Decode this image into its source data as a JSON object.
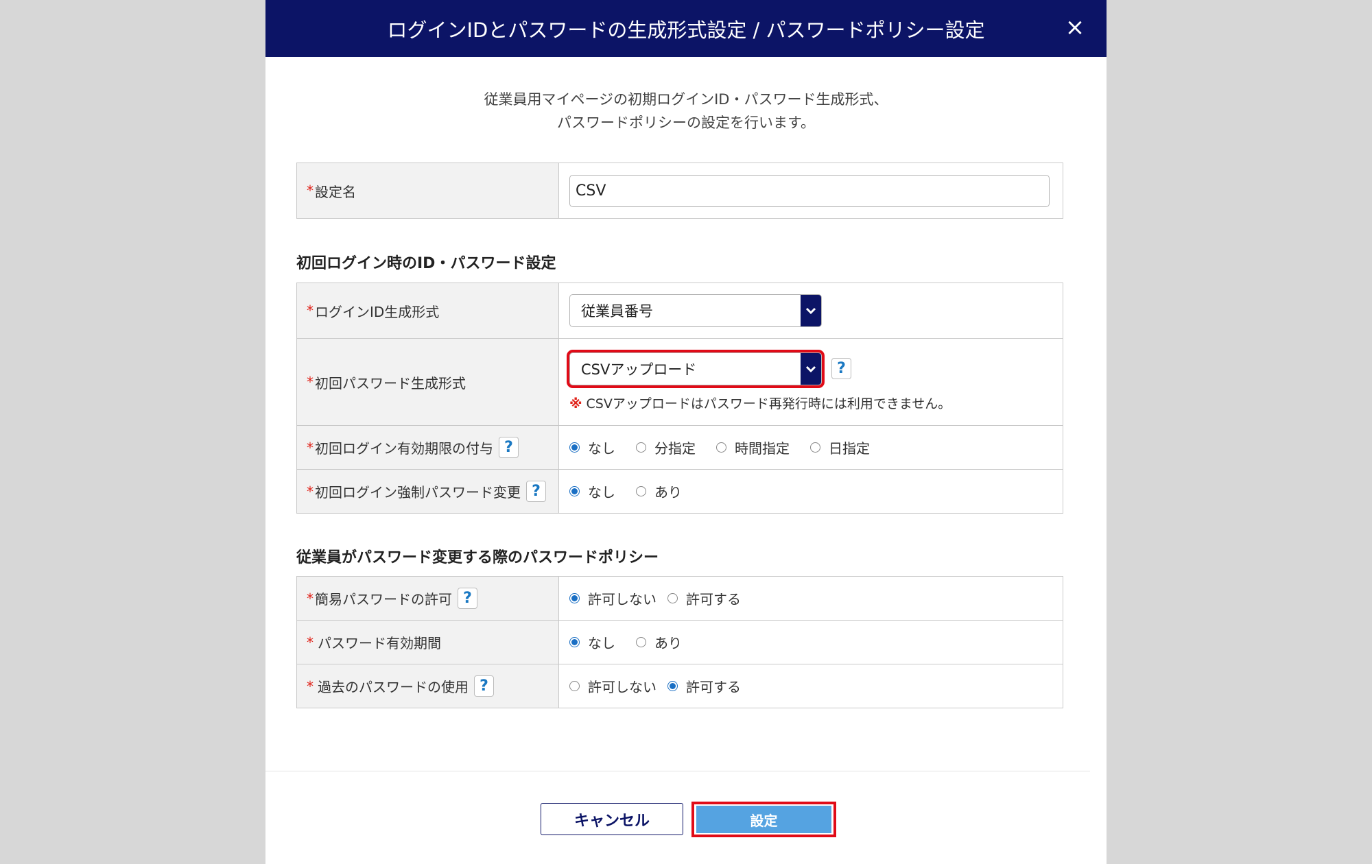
{
  "header": {
    "title": "ログインIDとパスワードの生成形式設定 / パスワードポリシー設定",
    "close_label": "×"
  },
  "intro": {
    "line1": "従業員用マイページの初期ログインID・パスワード生成形式、",
    "line2": "パスワードポリシーの設定を行います。"
  },
  "required_mark": "*",
  "setting_name": {
    "label": "設定名",
    "value": "CSV"
  },
  "section1": {
    "title": "初回ログイン時のID・パスワード設定",
    "login_id_format": {
      "label": "ログインID生成形式",
      "value": "従業員番号"
    },
    "initial_password_format": {
      "label": "初回パスワード生成形式",
      "value": "CSVアップロード",
      "note_mark": "※",
      "note": "CSVアップロードはパスワード再発行時には利用できません。"
    },
    "login_expiry": {
      "label": "初回ログイン有効期限の付与",
      "options": [
        "なし",
        "分指定",
        "時間指定",
        "日指定"
      ],
      "selected": "なし"
    },
    "force_change": {
      "label": "初回ログイン強制パスワード変更",
      "options": [
        "なし",
        "あり"
      ],
      "selected": "なし"
    }
  },
  "section2": {
    "title": "従業員がパスワード変更する際のパスワードポリシー",
    "simple_password": {
      "label": "簡易パスワードの許可",
      "options": [
        "許可しない",
        "許可する"
      ],
      "selected": "許可しない"
    },
    "password_expiry": {
      "label": "パスワード有効期間",
      "options": [
        "なし",
        "あり"
      ],
      "selected": "なし"
    },
    "past_password": {
      "label": "過去のパスワードの使用",
      "options": [
        "許可しない",
        "許可する"
      ],
      "selected": "許可する"
    }
  },
  "help_label": "?",
  "buttons": {
    "cancel": "キャンセル",
    "submit": "設定"
  },
  "colors": {
    "header": "#0c1466",
    "highlight": "#e00b17",
    "primary_button": "#55a3e1"
  }
}
